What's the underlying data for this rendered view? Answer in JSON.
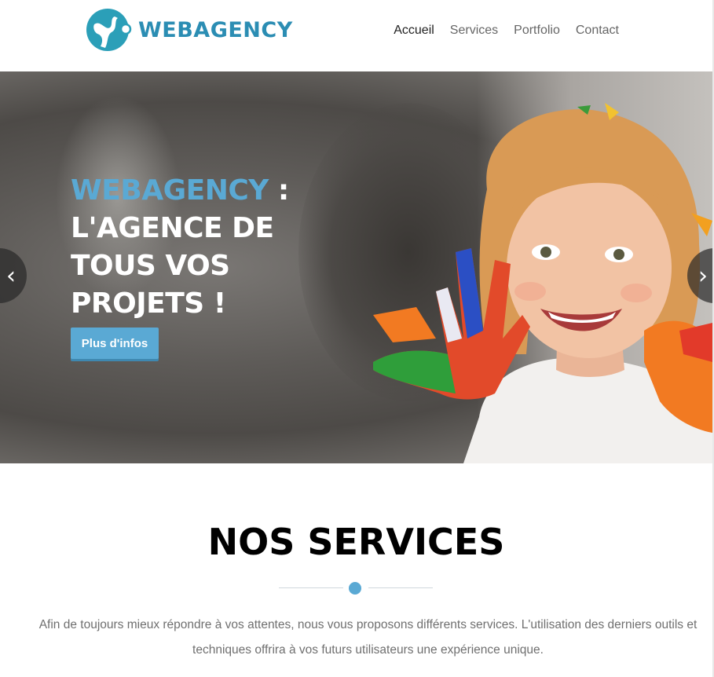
{
  "header": {
    "logo_text": "WEBAGENCY",
    "nav": [
      {
        "label": "Accueil",
        "active": true
      },
      {
        "label": "Services",
        "active": false
      },
      {
        "label": "Portfolio",
        "active": false
      },
      {
        "label": "Contact",
        "active": false
      }
    ]
  },
  "hero": {
    "title_brand": "WEBAGENCY",
    "title_colon": " :",
    "title_rest": "L'AGENCE DE TOUS VOS PROJETS !",
    "button_label": "Plus d'infos",
    "prev_arrow": "‹",
    "next_arrow": "›"
  },
  "services": {
    "title": "NOS SERVICES",
    "description": "Afin de toujours mieux répondre à vos attentes, nous vous proposons différents services. L'utilisation des derniers outils et techniques offrira à vos futurs utilisateurs une expérience unique."
  },
  "colors": {
    "accent": "#5aa9d4",
    "logo": "#2b8db3"
  },
  "icons": {
    "logo": "webagency-logo-icon",
    "prev": "chevron-left-icon",
    "next": "chevron-right-icon"
  }
}
